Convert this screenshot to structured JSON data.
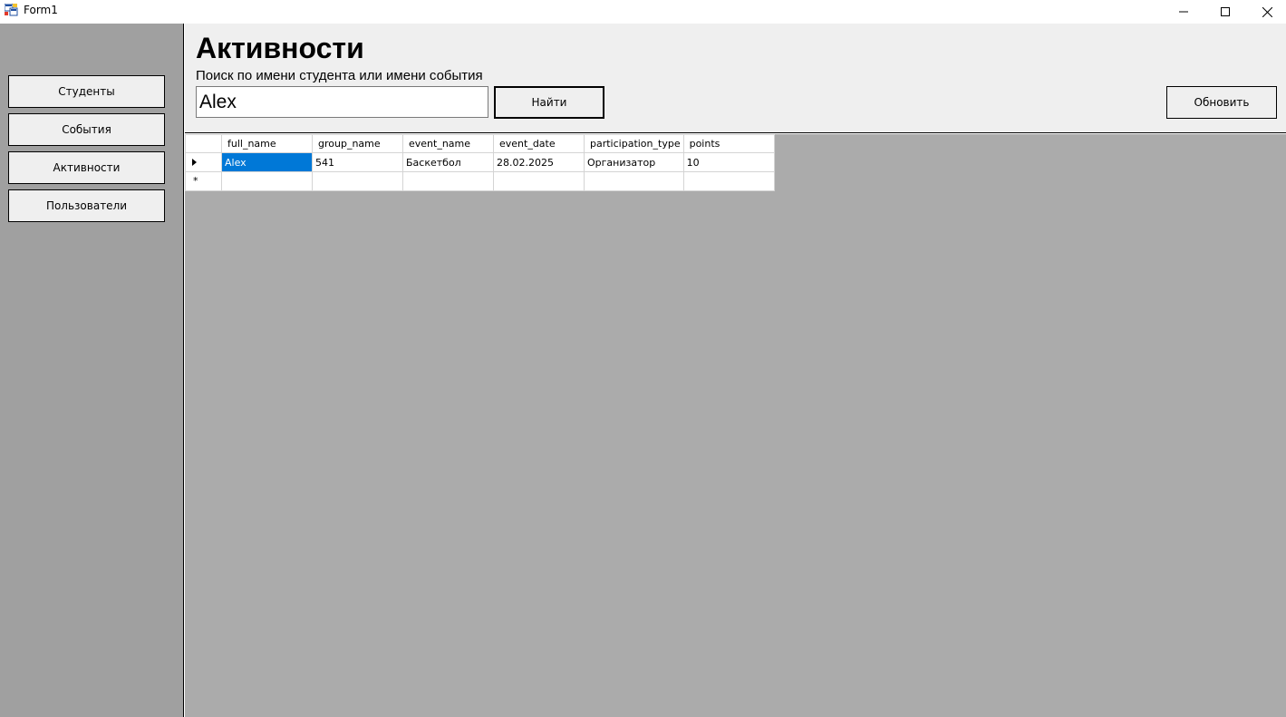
{
  "window": {
    "title": "Form1"
  },
  "sidebar": {
    "items": [
      {
        "label": "Студенты"
      },
      {
        "label": "События"
      },
      {
        "label": "Активности"
      },
      {
        "label": "Пользователи"
      }
    ]
  },
  "header": {
    "title": "Активности",
    "search_label": "Поиск по имени студента или имени события",
    "search_value": "Alex",
    "find_label": "Найти",
    "refresh_label": "Обновить"
  },
  "grid": {
    "columns": [
      "full_name",
      "group_name",
      "event_name",
      "event_date",
      "participation_type",
      "points"
    ],
    "rows": [
      [
        "Alex",
        "541",
        "Баскетбол",
        "28.02.2025",
        "Организатор",
        "10"
      ]
    ],
    "new_row_marker": "*"
  },
  "colors": {
    "sidebar_bg": "#a0a0a0",
    "header_bg": "#efefef",
    "grid_area_bg": "#ababab",
    "selection": "#0078d7"
  }
}
